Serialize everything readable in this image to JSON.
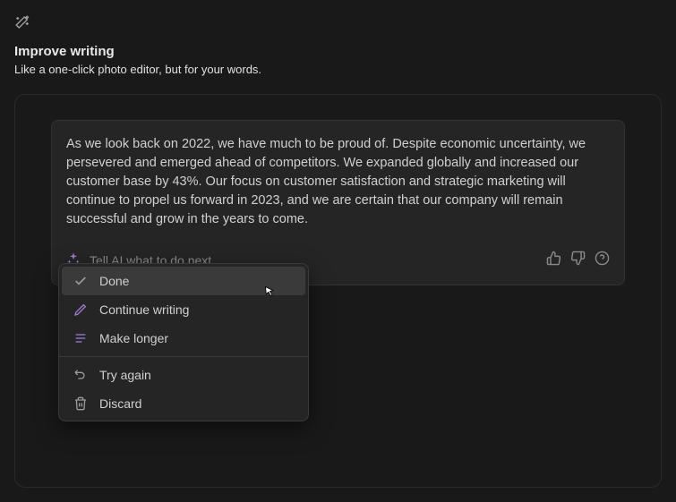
{
  "header": {
    "title": "Improve writing",
    "subtitle": "Like a one-click photo editor, but for your words."
  },
  "content": {
    "paragraph": "As we look back on 2022, we have much to be proud of. Despite economic uncertainty, we persevered and emerged ahead of competitors. We expanded globally and increased our customer base by 43%. Our focus on customer satisfaction and strategic marketing will continue to propel us forward in 2023, and we are certain that our company will remain successful and grow in the years to come."
  },
  "input": {
    "placeholder": "Tell AI what to do next..."
  },
  "menu": {
    "done": "Done",
    "continue_writing": "Continue writing",
    "make_longer": "Make longer",
    "try_again": "Try again",
    "discard": "Discard"
  }
}
